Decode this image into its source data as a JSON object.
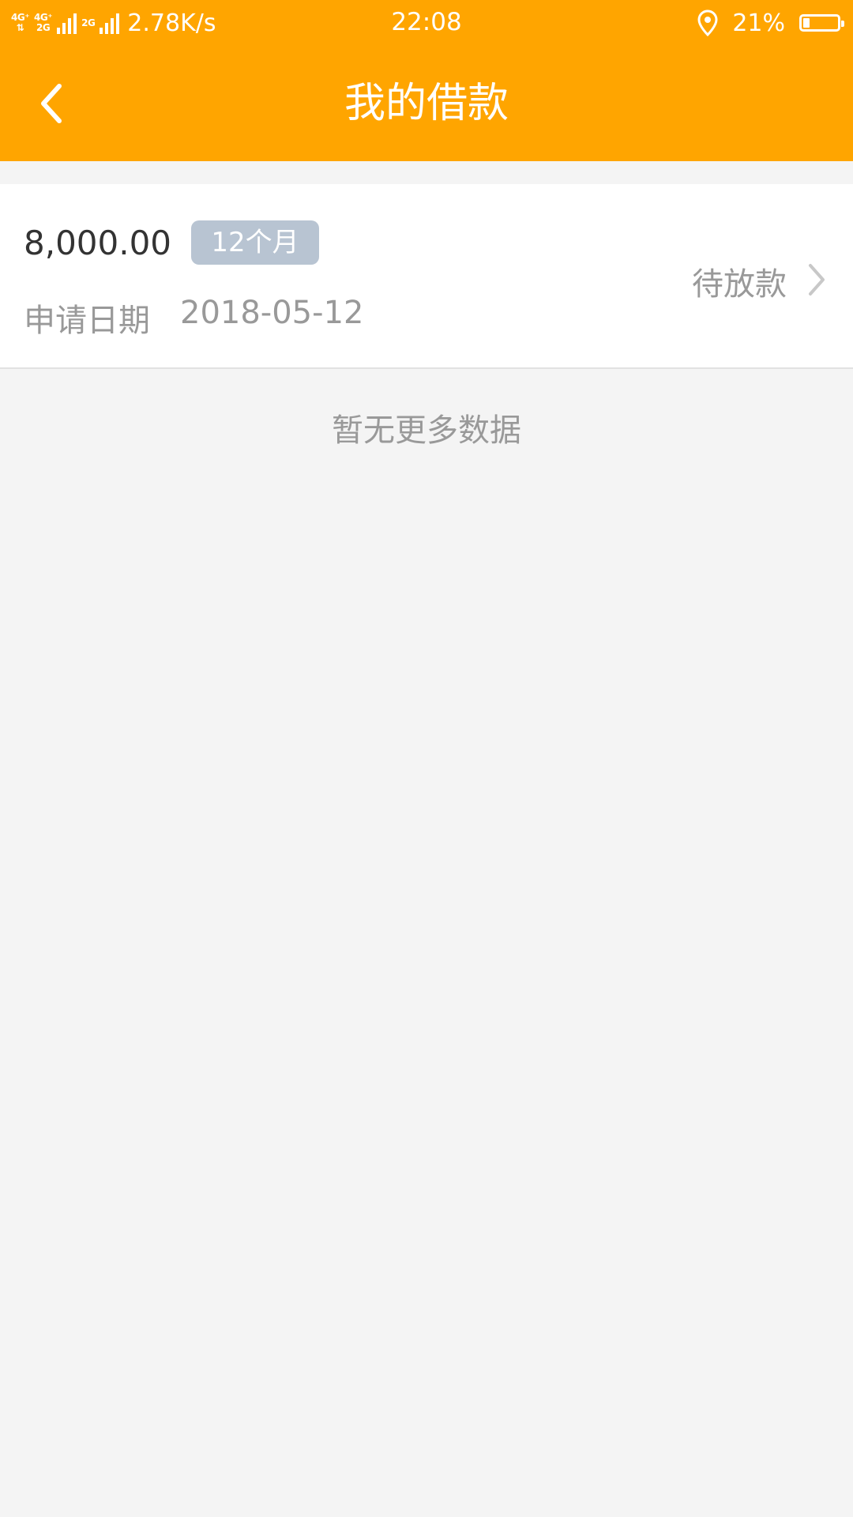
{
  "status_bar": {
    "network_1": "4G⁺",
    "network_1_sub": "⇅",
    "network_2": "4G⁺",
    "network_2_sub": "2G",
    "network_3": "2G",
    "net_speed": "2.78K/s",
    "time": "22:08",
    "battery_percent": "21%",
    "battery_level": 0.21,
    "icons": [
      "signal-icon",
      "location-icon",
      "battery-icon"
    ]
  },
  "header": {
    "title": "我的借款",
    "back_icon": "chevron-left-icon"
  },
  "loans": [
    {
      "amount": "8,000.00",
      "term": "12个月",
      "date_label": "申请日期",
      "date": "2018-05-12",
      "status": "待放款",
      "arrow_icon": "chevron-right-icon"
    }
  ],
  "list_footer": "暂无更多数据",
  "colors": {
    "primary": "#ffa500",
    "badge": "#b8c4d2",
    "text_dark": "#333333",
    "text_muted": "#999999",
    "background": "#f4f4f4"
  }
}
